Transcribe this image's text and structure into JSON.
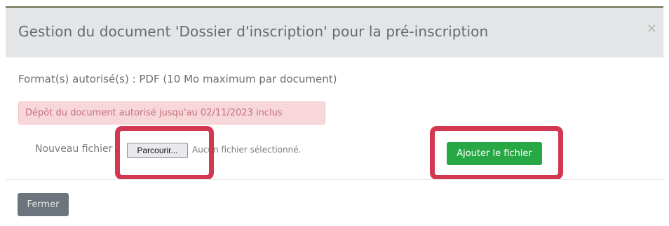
{
  "modal": {
    "title": "Gestion du document 'Dossier d'inscription' pour la pré-inscription",
    "close_symbol": "×"
  },
  "body": {
    "formats_text": "Format(s) autorisé(s) : PDF (10 Mo maximum par document)",
    "deadline_text": "Dépôt du document autorisé jusqu'au 02/11/2023 inclus",
    "upload": {
      "label": "Nouveau fichier :",
      "browse_label": "Parcourir...",
      "status": "Aucun fichier sélectionné."
    },
    "add_button_label": "Ajouter le fichier"
  },
  "footer": {
    "close_label": "Fermer"
  },
  "colors": {
    "header_bg": "#e3e5e7",
    "alert_bg": "#f8d7da",
    "alert_text": "#c4707c",
    "success": "#28a745",
    "secondary": "#6c757d",
    "highlight": "#d23852"
  },
  "icons": {
    "close": "close-icon"
  }
}
